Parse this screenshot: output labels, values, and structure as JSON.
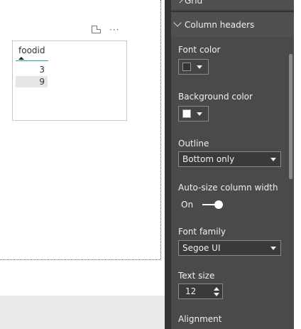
{
  "visual": {
    "column_header": "foodid",
    "rows": [
      "3",
      "9"
    ],
    "more_options": "···"
  },
  "pane": {
    "section_grid": "Grid",
    "section_column_headers": "Column headers",
    "font_color_label": "Font color",
    "font_color_value": "#333333",
    "background_color_label": "Background color",
    "background_color_value": "#ffffff",
    "outline_label": "Outline",
    "outline_value": "Bottom only",
    "autosize_label": "Auto-size column width",
    "autosize_state": "On",
    "font_family_label": "Font family",
    "font_family_value": "Segoe UI",
    "text_size_label": "Text size",
    "text_size_value": "12",
    "alignment_label": "Alignment"
  },
  "colors": {
    "pane_bg": "#4a4a4a",
    "header_underline": "#23a8a0"
  }
}
